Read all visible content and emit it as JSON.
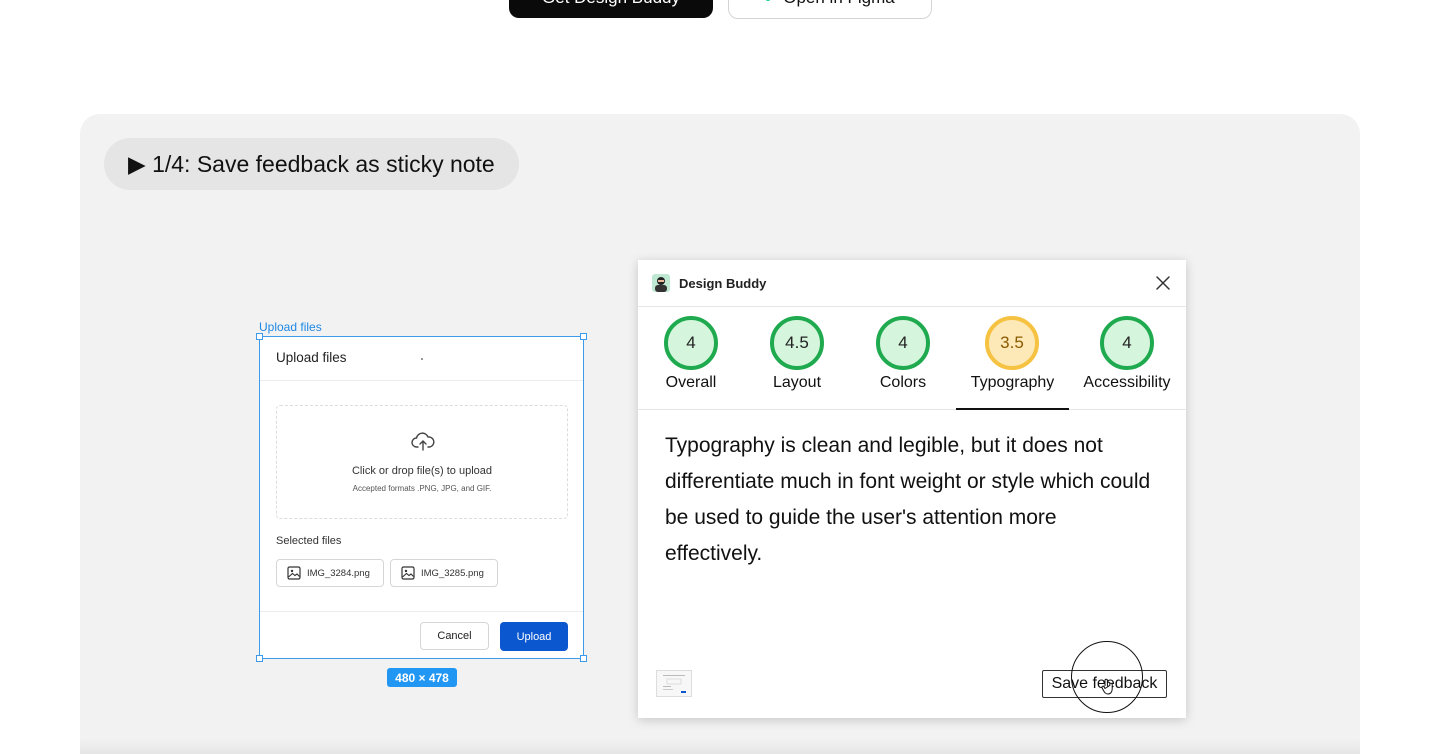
{
  "top_buttons": {
    "primary_label": "Get Design Buddy",
    "secondary_label": "Open in Figma"
  },
  "demo": {
    "step_label": "▶ 1/4: Save feedback as sticky note"
  },
  "upload_frame": {
    "frame_label": "Upload files",
    "title": "Upload files",
    "dropzone_text": "Click or drop file(s) to upload",
    "dropzone_subtext": "Accepted formats .PNG, JPG, and GIF.",
    "selected_files_label": "Selected files",
    "files": [
      "IMG_3284.png",
      "IMG_3285.png"
    ],
    "cancel_label": "Cancel",
    "upload_label": "Upload",
    "dimensions": "480 × 478"
  },
  "plugin": {
    "title": "Design Buddy",
    "scores": [
      {
        "label": "Overall",
        "value": "4",
        "ring_color": "#1faa4f",
        "fill": "#d6f5dd"
      },
      {
        "label": "Layout",
        "value": "4.5",
        "ring_color": "#1faa4f",
        "fill": "#d6f5dd"
      },
      {
        "label": "Colors",
        "value": "4",
        "ring_color": "#1faa4f",
        "fill": "#d6f5dd"
      },
      {
        "label": "Typography",
        "value": "3.5",
        "ring_color": "#f5c242",
        "fill": "#fde9b8"
      },
      {
        "label": "Accessibility",
        "value": "4",
        "ring_color": "#1faa4f",
        "fill": "#d6f5dd"
      }
    ],
    "active_tab": "Typography",
    "feedback": "Typography is clean and legible, but it does not differentiate much in font weight or style which could be used to guide the user's attention more effectively.",
    "save_label": "Save feedback"
  }
}
